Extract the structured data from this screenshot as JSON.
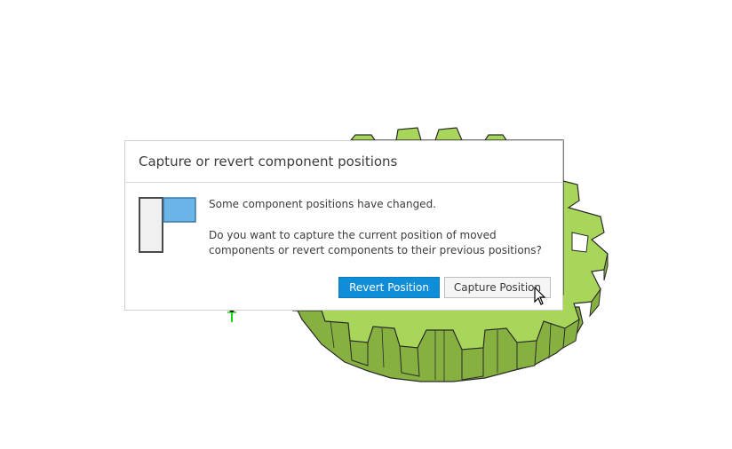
{
  "dialog": {
    "title": "Capture or revert component positions",
    "message_line1": "Some component positions have changed.",
    "message_line2": "Do you want to capture the current position of moved components or revert components to their previous positions?",
    "revert_label": "Revert Position",
    "capture_label": "Capture Position",
    "icon": "component-position-icon"
  },
  "colors": {
    "gear_fill": "#a8d65a",
    "gear_side": "#86b040",
    "gear_outline": "#2a2a2a",
    "primary_button": "#0f8dd9",
    "icon_accent": "#6ab4e8",
    "axis_green": "#1bd11b"
  }
}
